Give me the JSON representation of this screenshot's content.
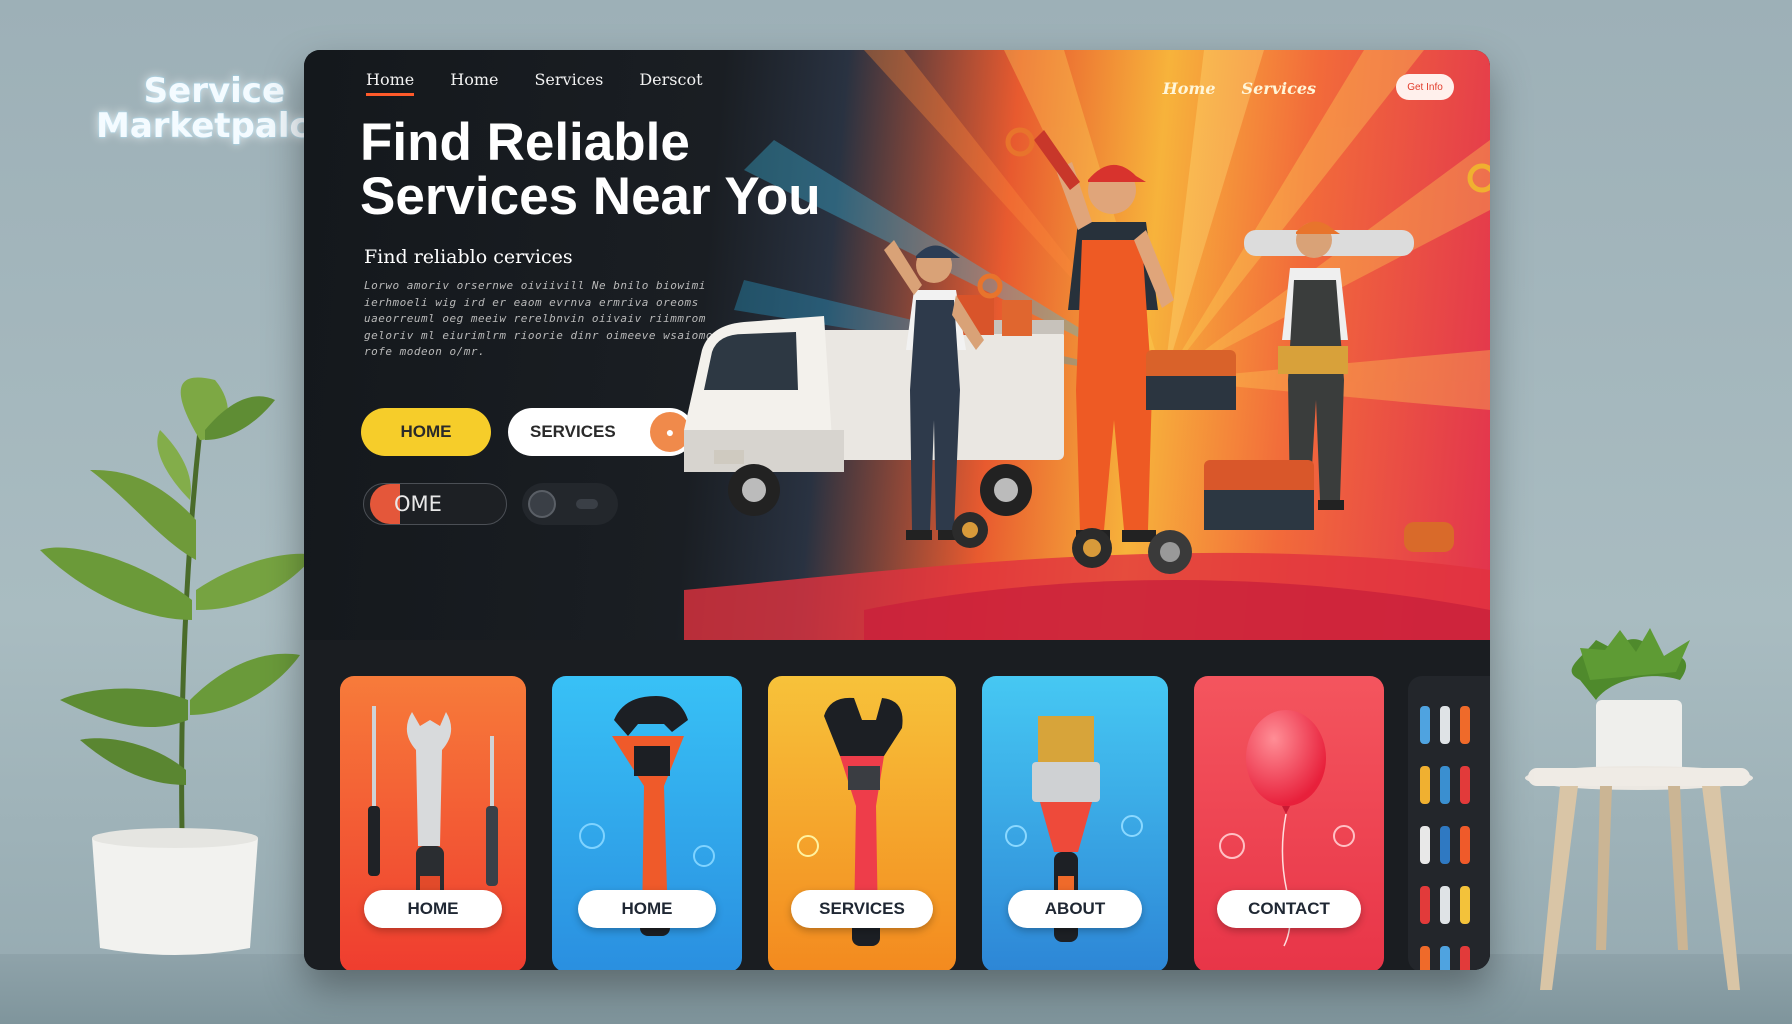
{
  "brand": {
    "line1": "Service",
    "line2": "Marketpalce"
  },
  "nav_left": [
    {
      "label": "Home",
      "active": true
    },
    {
      "label": "Home",
      "active": false
    },
    {
      "label": "Services",
      "active": false
    },
    {
      "label": "Derscot",
      "active": false
    }
  ],
  "nav_right": [
    {
      "label": "Home"
    },
    {
      "label": "Services"
    }
  ],
  "nav_pill_label": "Get Info",
  "hero": {
    "headline_line1": "Find Reliable",
    "headline_line2": "Services Near You",
    "subheadline": "Find reliablo cervices",
    "lorem_lines": [
      "Lorwo amoriv orsernwe oiviivill Ne bnilo biowimi",
      "ierhmoeli wig ird er eaom evrnva ermriva oreoms",
      "uaeorreuml oeg meeiw rerelbnvin oiivaiv riimmrom",
      "geloriv ml eiurimlrm rioorie dinr oimeeve wsaiomo",
      "rofe modeon o/mr."
    ],
    "btn_home": "HOME",
    "btn_services": "SERVICES",
    "btn_ome": "OME"
  },
  "cards": [
    {
      "label": "HOME",
      "bg": "#f4583a"
    },
    {
      "label": "HOME",
      "bg": "#3fb4ee"
    },
    {
      "label": "SERVICES",
      "bg": "#f7a21f"
    },
    {
      "label": "ABOUT",
      "bg": "#3ab6f0"
    },
    {
      "label": "CONTACT",
      "bg": "#f2475a"
    }
  ],
  "colors": {
    "accent": "#ff5a2a",
    "yellow": "#f6cd2a",
    "dark": "#15191d"
  }
}
